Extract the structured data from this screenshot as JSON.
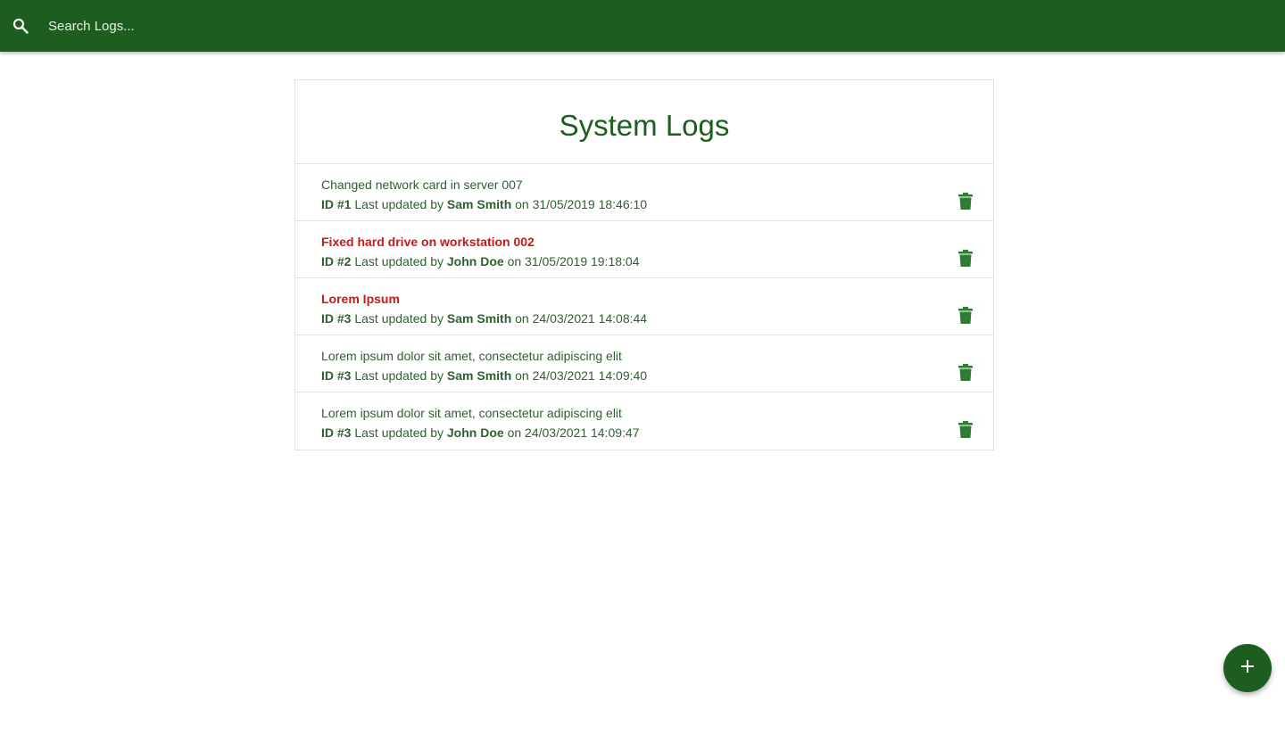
{
  "search": {
    "placeholder": "Search Logs...",
    "value": "",
    "icon": "search-icon"
  },
  "page": {
    "title": "System Logs"
  },
  "logs": [
    {
      "message": "Changed network card in server 007",
      "attention": false,
      "id_label": "ID #1",
      "updated_by_text": "Last updated by",
      "tech": "Sam Smith",
      "on_text": "on",
      "date": "31/05/2019 18:46:10"
    },
    {
      "message": "Fixed hard drive on workstation 002",
      "attention": true,
      "id_label": "ID #2",
      "updated_by_text": "Last updated by",
      "tech": "John Doe",
      "on_text": "on",
      "date": "31/05/2019 19:18:04"
    },
    {
      "message": "Lorem Ipsum",
      "attention": true,
      "id_label": "ID #3",
      "updated_by_text": "Last updated by",
      "tech": "Sam Smith",
      "on_text": "on",
      "date": "24/03/2021 14:08:44"
    },
    {
      "message": "Lorem ipsum dolor sit amet, consectetur adipiscing elit",
      "attention": false,
      "id_label": "ID #3",
      "updated_by_text": "Last updated by",
      "tech": "Sam Smith",
      "on_text": "on",
      "date": "24/03/2021 14:09:40"
    },
    {
      "message": "Lorem ipsum dolor sit amet, consectetur adipiscing elit",
      "attention": false,
      "id_label": "ID #3",
      "updated_by_text": "Last updated by",
      "tech": "John Doe",
      "on_text": "on",
      "date": "24/03/2021 14:09:47"
    }
  ],
  "icons": {
    "delete": "trash-icon",
    "add": "plus-icon"
  },
  "colors": {
    "brand": "#1d5e20",
    "text": "#2f5f2f",
    "attention": "#c41a1a",
    "delete_icon": "#2e7d32"
  }
}
